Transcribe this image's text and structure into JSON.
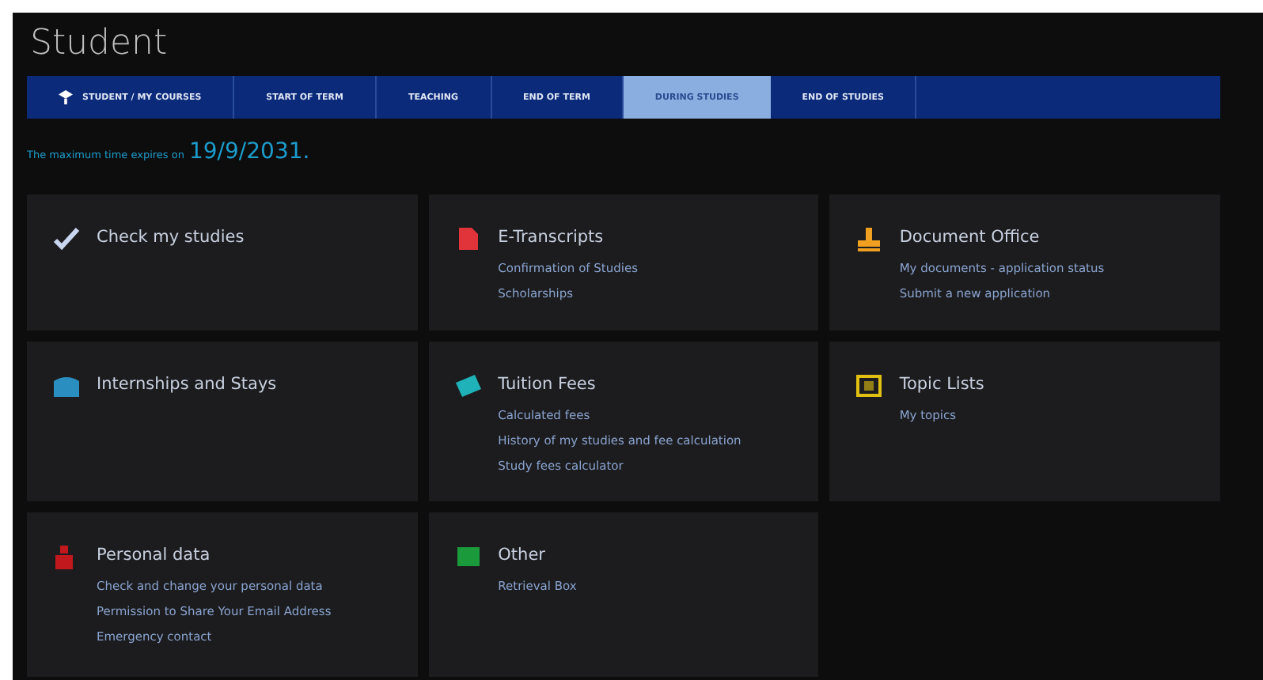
{
  "title": "Student",
  "tabs": [
    {
      "label": "STUDENT / MY COURSES",
      "selected": false,
      "icon": true
    },
    {
      "label": "START OF TERM",
      "selected": false
    },
    {
      "label": "TEACHING",
      "selected": false
    },
    {
      "label": "END OF TERM",
      "selected": false
    },
    {
      "label": "DURING STUDIES",
      "selected": true
    },
    {
      "label": "END OF STUDIES",
      "selected": false
    }
  ],
  "expiry": {
    "text": "The maximum time expires on",
    "date": "19/9/2031",
    "suffix": "."
  },
  "cards": [
    {
      "title": "Check my studies",
      "kind": "check",
      "color": "#c9d6f0"
    },
    {
      "title": "E-Transcripts",
      "kind": "document",
      "color": "#e0343a",
      "links": [
        "Confirmation of Studies",
        "Scholarships"
      ]
    },
    {
      "title": "Document Office",
      "kind": "stamp",
      "color": "#f0a020",
      "links": [
        "My documents - application status",
        "Submit a new application"
      ]
    },
    {
      "title": "Internships and Stays",
      "kind": "building",
      "color": "#2a8fc0"
    },
    {
      "title": "Tuition Fees",
      "kind": "ticket",
      "color": "#1fb2b8",
      "links": [
        "Calculated fees",
        "History of my studies and fee calculation",
        "Study fees calculator"
      ]
    },
    {
      "title": "Topic Lists",
      "kind": "list",
      "color": "#e0c010",
      "links": [
        "My topics"
      ]
    },
    {
      "title": "Personal data",
      "kind": "person",
      "color": "#c0181c",
      "links": [
        "Check and change your personal data",
        "Permission to Share Your Email Address",
        "Emergency contact"
      ]
    },
    {
      "title": "Other",
      "kind": "grid",
      "color": "#1a9a3a",
      "links": [
        "Retrieval Box"
      ]
    }
  ]
}
